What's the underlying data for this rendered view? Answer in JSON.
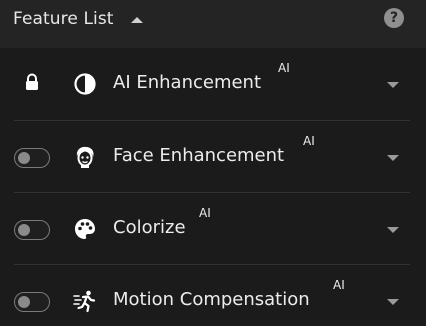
{
  "header": {
    "title": "Feature List",
    "caret_icon": "caret-up-icon",
    "help_icon": "help-icon",
    "help_glyph": "?"
  },
  "features": [
    {
      "label": "AI Enhancement",
      "badge": "AI",
      "control": "locked",
      "icon": "contrast-icon"
    },
    {
      "label": "Face Enhancement",
      "badge": "AI",
      "control": "toggle-off",
      "icon": "face-icon"
    },
    {
      "label": "Colorize",
      "badge": "AI",
      "control": "toggle-off",
      "icon": "palette-icon"
    },
    {
      "label": "Motion Compensation",
      "badge": "AI",
      "control": "toggle-off",
      "icon": "running-figure-icon"
    }
  ],
  "colors": {
    "background": "#1b1b1b",
    "header": "#242424",
    "text": "#ececec",
    "muted": "#8a8a8a"
  }
}
